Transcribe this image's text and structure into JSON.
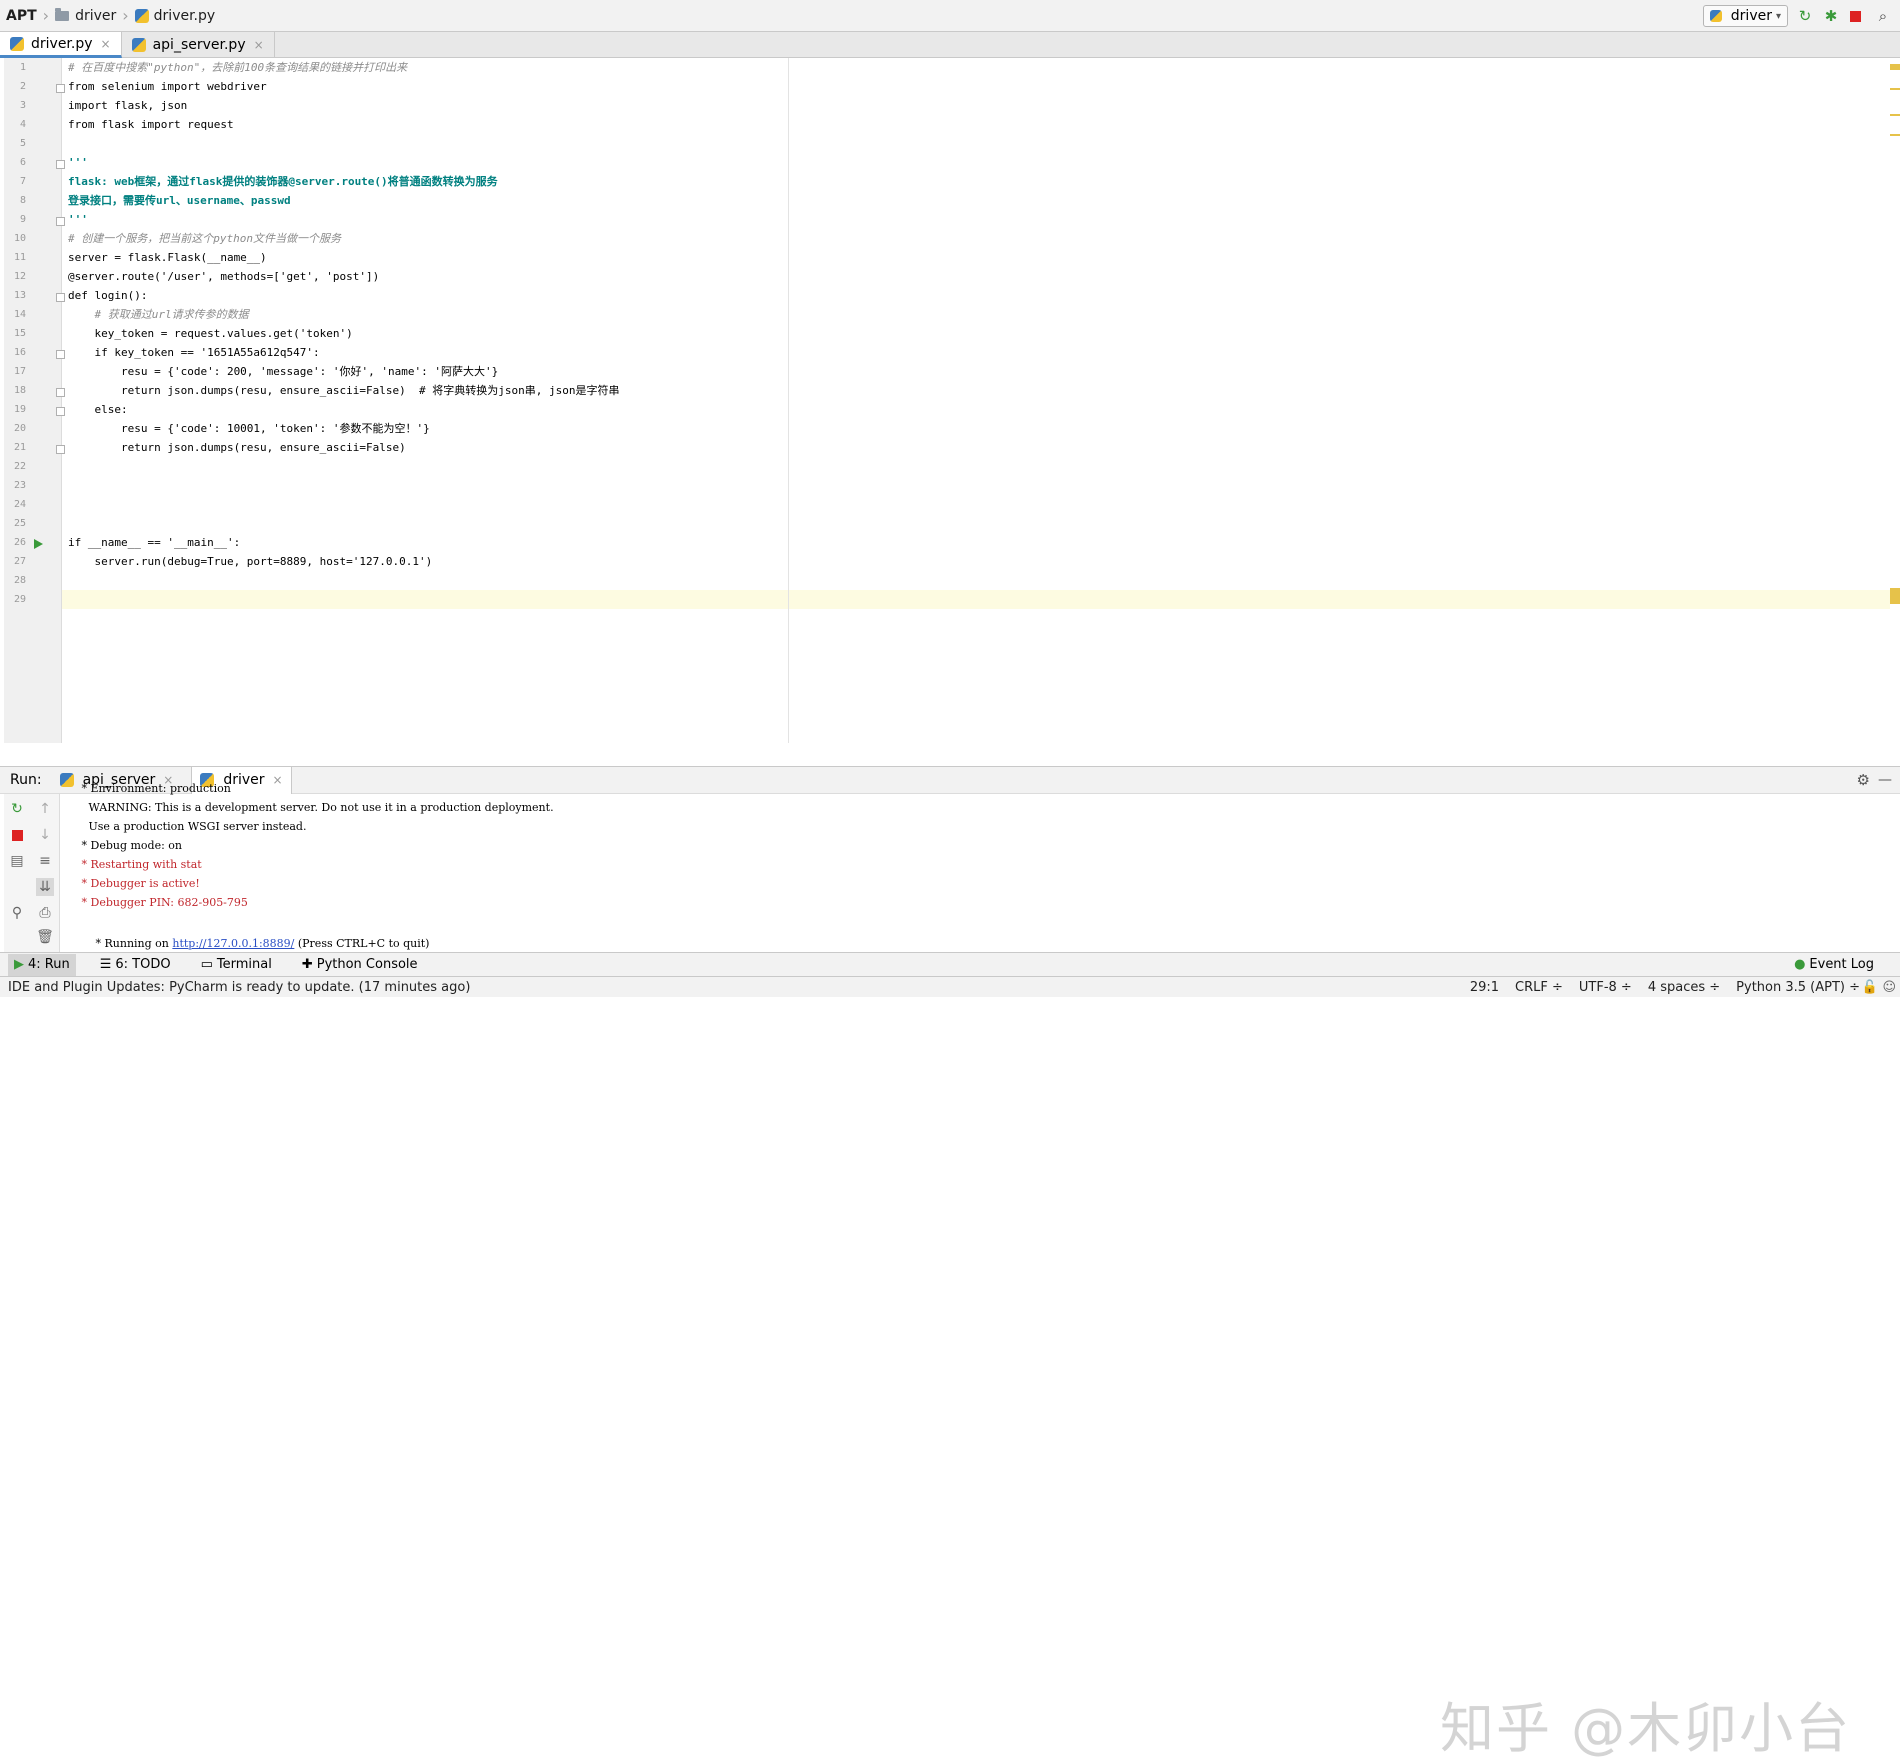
{
  "breadcrumb": [
    "APT",
    "driver",
    "driver.py"
  ],
  "run_config": "driver",
  "editor_tabs": [
    {
      "label": "driver.py",
      "active": true
    },
    {
      "label": "api_server.py",
      "active": false
    }
  ],
  "code_lines": [
    "# 在百度中搜索\"python\"，去除前100条查询结果的链接并打印出来",
    "from selenium import webdriver",
    "import flask, json",
    "from flask import request",
    "",
    "'''",
    "flask: web框架，通过flask提供的装饰器@server.route()将普通函数转换为服务",
    "登录接口，需要传url、username、passwd",
    "'''",
    "# 创建一个服务，把当前这个python文件当做一个服务",
    "server = flask.Flask(__name__)",
    "@server.route('/user', methods=['get', 'post'])",
    "def login():",
    "    # 获取通过url请求传参的数据",
    "    key_token = request.values.get('token')",
    "    if key_token == '1651A55a612q547':",
    "        resu = {'code': 200, 'message': '你好', 'name': '阿萨大大'}",
    "        return json.dumps(resu, ensure_ascii=False)  # 将字典转换为json串, json是字符串",
    "    else:",
    "        resu = {'code': 10001, 'token': '参数不能为空！'}",
    "        return json.dumps(resu, ensure_ascii=False)",
    "",
    "",
    "",
    "",
    "if __name__ == '__main__':",
    "    server.run(debug=True, port=8889, host='127.0.0.1')",
    "",
    ""
  ],
  "run_panel": {
    "title": "Run:",
    "tabs": [
      {
        "label": "api_server",
        "active": false
      },
      {
        "label": "driver",
        "active": true
      }
    ],
    "console_lines": [
      {
        "text": " * Environment: production",
        "color": "black"
      },
      {
        "text": "   WARNING: This is a development server. Do not use it in a production deployment.",
        "color": "black"
      },
      {
        "text": "   Use a production WSGI server instead.",
        "color": "black"
      },
      {
        "text": " * Debug mode: on",
        "color": "black"
      },
      {
        "text": " * Restarting with stat",
        "color": "red"
      },
      {
        "text": " * Debugger is active!",
        "color": "red"
      },
      {
        "text": " * Debugger PIN: 682-905-795",
        "color": "red"
      }
    ],
    "running_line": {
      "prefix": " * Running on ",
      "link": "http://127.0.0.1:8889/",
      "suffix": " (Press CTRL+C to quit)"
    }
  },
  "watermark": "知乎 @木卯小台",
  "bottom_tabs": [
    "4: Run",
    "6: TODO",
    "Terminal",
    "Python Console"
  ],
  "event_log": "Event Log",
  "status": {
    "message": "IDE and Plugin Updates: PyCharm is ready to update. (17 minutes ago)",
    "position": "29:1",
    "line_sep": "CRLF ÷",
    "encoding": "UTF-8 ÷",
    "indent": "4 spaces ÷",
    "interpreter": "Python 3.5 (APT) ÷"
  }
}
